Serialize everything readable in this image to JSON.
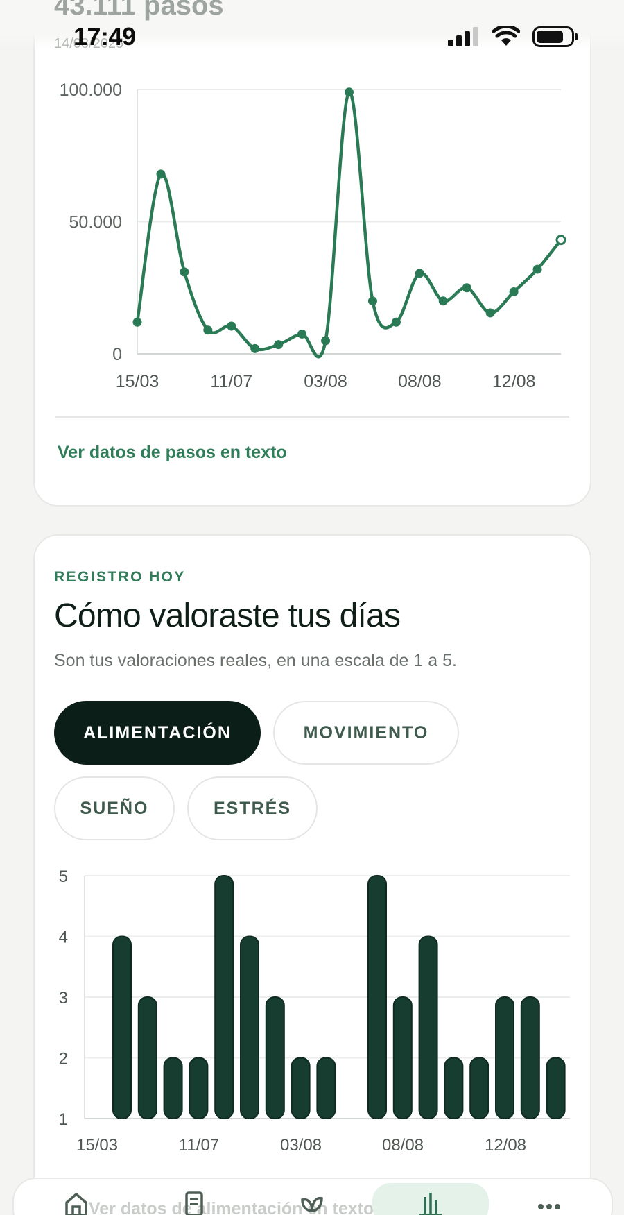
{
  "status_bar": {
    "time": "17:49",
    "icons": [
      "signal-icon",
      "wifi-icon",
      "battery-icon"
    ]
  },
  "steps_card": {
    "title": "43.111 pasos",
    "date": "14/08/2025",
    "link_text": "Ver datos de pasos en texto"
  },
  "ratings_card": {
    "eyebrow": "REGISTRO HOY",
    "title": "Cómo valoraste tus días",
    "subtitle": "Son tus valoraciones reales, en una escala de 1 a 5.",
    "tabs": [
      {
        "label": "ALIMENTACIÓN",
        "active": true
      },
      {
        "label": "MOVIMIENTO",
        "active": false
      },
      {
        "label": "SUEÑO",
        "active": false
      },
      {
        "label": "ESTRÉS",
        "active": false
      }
    ]
  },
  "bottom_nav": {
    "faded_link_text": "Ver datos de alimentación en texto",
    "items": [
      "home-icon",
      "journal-icon",
      "leaf-icon",
      "chart-icon",
      "more-icon"
    ],
    "active_index": 3
  },
  "colors": {
    "accent": "#2f7d59",
    "line": "#2a7a55",
    "bar": "#173d30",
    "active_pill": "#0c1e18"
  },
  "chart_data": [
    {
      "type": "line",
      "x": [
        "15/03",
        "",
        "",
        "",
        "11/07",
        "",
        "",
        "",
        "03/08",
        "",
        "",
        "",
        "08/08",
        "",
        "",
        "",
        "12/08",
        "",
        ""
      ],
      "xticks": [
        "15/03",
        "11/07",
        "03/08",
        "08/08",
        "12/08"
      ],
      "values": [
        12000,
        68000,
        31000,
        9000,
        10500,
        2000,
        3500,
        7500,
        5000,
        99000,
        20000,
        12000,
        30500,
        20000,
        25000,
        15500,
        23500,
        32000,
        43111
      ],
      "yticks": [
        "100.000",
        "50.000",
        "0"
      ],
      "ylim": [
        0,
        100000
      ],
      "grid": true
    },
    {
      "type": "bar",
      "xticks": [
        "15/03",
        "11/07",
        "03/08",
        "08/08",
        "12/08"
      ],
      "values": [
        4,
        3,
        2,
        2,
        5,
        4,
        3,
        2,
        2,
        null,
        5,
        3,
        4,
        2,
        2,
        3,
        3,
        2
      ],
      "yticks": [
        "5",
        "4",
        "3",
        "2",
        "1"
      ],
      "ylim": [
        1,
        5
      ],
      "grid": true
    }
  ]
}
